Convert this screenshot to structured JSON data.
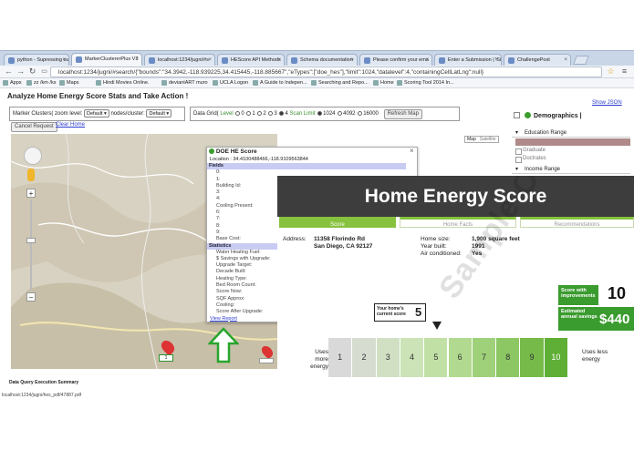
{
  "browser": {
    "tabs": [
      {
        "label": "python - Supressing ou",
        "active": false
      },
      {
        "label": "MarkerClustererPlus V3",
        "active": true
      },
      {
        "label": "localhost:1234/jugni/#s",
        "active": false
      },
      {
        "label": "HEScore API Methods",
        "active": false
      },
      {
        "label": "Schema documentation",
        "active": false
      },
      {
        "label": "Please confirm your ema",
        "active": false
      },
      {
        "label": "Enter a Submission | 'Si",
        "active": false
      },
      {
        "label": "ChallengePost",
        "active": false
      }
    ],
    "url": "localhost:1234/jugni/#search/{\"bounds\":\"34.3942,-118.939225,34.415445,-118.885667\",\"eTypes\":[\"doe_hes\"],\"limit\":1024,\"datalevel\":4,\"containingCellLatLng\":null}",
    "bookmarks": [
      "Apps",
      "zz /km /ks",
      "Maps",
      "Hindi Movies Online.",
      "deviantART muro",
      "UCLA Logon",
      "A Guide to Indepen...",
      "Searching and Repo...",
      "Home",
      "Scoring Tool 2014 In..."
    ]
  },
  "app": {
    "title": "Analyze Home Energy Score Stats and Take Action !",
    "show_json": "Show JSON",
    "marker_clusters_label": "Marker Clusters( zoom level:",
    "zoom_default": "Default",
    "nodes_label": "nodes/cluster:",
    "nodes_default": "Default",
    "cancel_request": "Cancel Request",
    "clear_home": "Clear Home",
    "data_grid_label": "Data Grid(",
    "level_label": "Level",
    "levels": [
      "0",
      "1",
      "2",
      "3",
      "4"
    ],
    "scan_limit_label": "Scan Limit",
    "scan_limits": [
      "1024",
      "4092",
      "16000"
    ],
    "refresh_map": "Refresh Map",
    "map_types": [
      "Map",
      "Satellite"
    ],
    "data_query_summary": "Data Query Execution Summary",
    "status_url": "localhost:1234/jugni/hes_pdf/47887.pdf"
  },
  "popup": {
    "title": "DOE HE Score",
    "location": "Location : 34.4100488466,-118.9109563844",
    "fields_label": "Fields",
    "fields": [
      "0:",
      "1:",
      "Building Id:",
      "3:",
      "4:",
      "Cooling Present:",
      "6:",
      "7:",
      "8:",
      "9:",
      "Base Cost:"
    ],
    "statistics_label": "Statistics",
    "stats": [
      "Water Heating Fuel:",
      "$ Savings with Upgrade:",
      "Upgrade Target:",
      "Decade Built:",
      "Heating Type:",
      "Bed Room Count:",
      "Score Now:",
      "SQF Approx:",
      "Cooling:",
      "Score After Upgrade:"
    ],
    "view_report": "View Report",
    "close": "×"
  },
  "sidebar": {
    "title": "Demographics |",
    "education_range": "Education Range",
    "education_items": [
      "Graduate",
      "Doctrates"
    ],
    "income_range": "Income Range"
  },
  "hes": {
    "title": "Home Energy Score",
    "tabs": [
      "Score",
      "Home Facts",
      "Recommendations"
    ],
    "address_label": "Address:",
    "address_line1": "11358 Florindo Rd",
    "address_line2": "San Diego, CA 92127",
    "home_size_label": "Home size:",
    "home_size": "1,900 square feet",
    "year_built_label": "Year built:",
    "year_built": "1991",
    "ac_label": "Air conditioned:",
    "ac": "Yes",
    "watermark": "Sample Only",
    "current_score_label": "Your home's current score",
    "current_score": "5",
    "score_with_improvements_label": "Score with improvements",
    "score_with_improvements": "10",
    "annual_savings_label": "Estimated annual savings",
    "annual_savings": "$440",
    "uses_more": "Uses more energy",
    "uses_less": "Uses less energy",
    "scale": [
      "1",
      "2",
      "3",
      "4",
      "5",
      "6",
      "7",
      "8",
      "9",
      "10"
    ],
    "scale_colors": [
      "#d9d9d9",
      "#d6dcd0",
      "#d1e0c3",
      "#cbe3b6",
      "#c1e0a6",
      "#b1d98f",
      "#9fd07a",
      "#8cc764",
      "#76bb4a",
      "#5fae35"
    ]
  },
  "map_markers": [
    "1",
    ""
  ]
}
